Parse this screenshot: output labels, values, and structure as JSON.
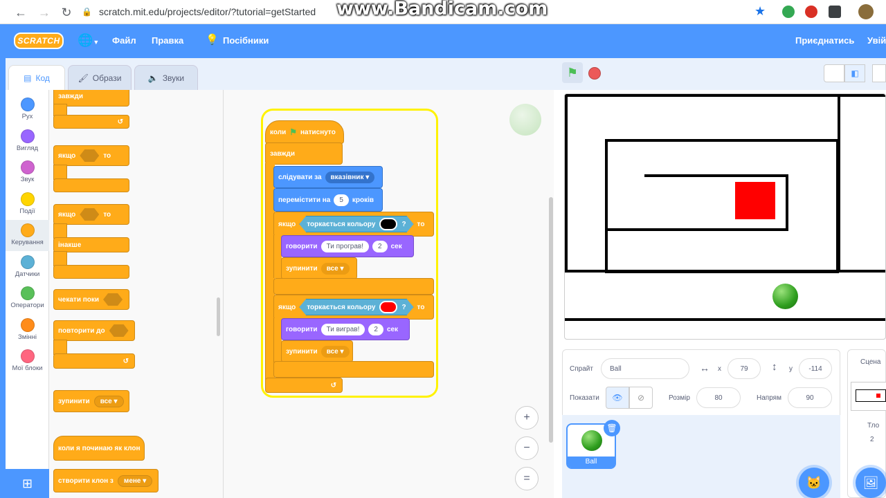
{
  "browser": {
    "url": "scratch.mit.edu/projects/editor/?tutorial=getStarted",
    "watermark": "www.Bandicam.com"
  },
  "menu": {
    "logo": "SCRATCH",
    "file": "Файл",
    "edit": "Правка",
    "tutorials": "Посібники",
    "join": "Приєднатись",
    "signin": "Увій"
  },
  "tabs": {
    "code": "Код",
    "costumes": "Образи",
    "sounds": "Звуки"
  },
  "categories": [
    {
      "label": "Рух",
      "color": "#4c97ff"
    },
    {
      "label": "Вигляд",
      "color": "#9966ff"
    },
    {
      "label": "Звук",
      "color": "#cf63cf"
    },
    {
      "label": "Події",
      "color": "#ffd500"
    },
    {
      "label": "Керування",
      "color": "#ffab19"
    },
    {
      "label": "Датчики",
      "color": "#5cb1d6"
    },
    {
      "label": "Оператори",
      "color": "#59c059"
    },
    {
      "label": "Змінні",
      "color": "#ff8c1a"
    },
    {
      "label": "Мої блоки",
      "color": "#ff6680"
    }
  ],
  "palette": {
    "forever": "завжди",
    "if": "якщо",
    "then": "то",
    "if2": "якщо",
    "then2": "то",
    "else": "інакше",
    "wait_until": "чекати поки",
    "repeat_until": "повторити до",
    "stop": "зупинити",
    "stop_opt": "все",
    "when_clone": "коли я починаю як клон",
    "create_clone": "створити клон з",
    "create_clone_opt": "мене"
  },
  "script": {
    "hat": "коли",
    "hat2": "натиснуто",
    "forever": "завжди",
    "follow": "слідувати за",
    "follow_opt": "вказівник",
    "move": "перемістити на",
    "move_val": "5",
    "move_unit": "кроків",
    "if1": "якщо",
    "touching1": "торкається кольору",
    "q1": "?",
    "then1": "то",
    "say1": "говорити",
    "say1_text": "Ти програв!",
    "say1_secs": "2",
    "sec1": "сек",
    "stop1": "зупинити",
    "stop1_opt": "все",
    "if2": "якщо",
    "touching2": "торкається кольору",
    "q2": "?",
    "then2": "то",
    "say2": "говорити",
    "say2_text": "Ти виграв!",
    "say2_secs": "2",
    "sec2": "сек",
    "stop2": "зупинити",
    "stop2_opt": "все"
  },
  "zoom": {
    "in": "+",
    "out": "−",
    "reset": "="
  },
  "sprite": {
    "label": "Спрайт",
    "name": "Ball",
    "x_label": "x",
    "x": "79",
    "y_label": "y",
    "y": "-114",
    "show_label": "Показати",
    "size_label": "Розмір",
    "size": "80",
    "dir_label": "Напрям",
    "direction": "90",
    "thumb_name": "Ball"
  },
  "stage_panel": {
    "title": "Сцена",
    "backdrops_label": "Тло",
    "backdrops": "2"
  }
}
